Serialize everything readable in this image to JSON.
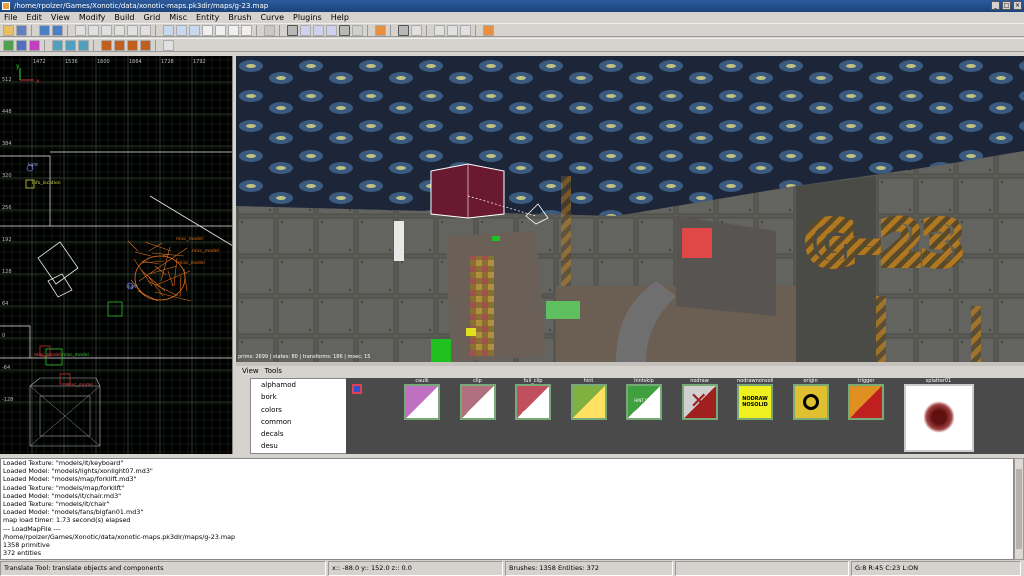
{
  "window": {
    "title": "/home/rpolzer/Games/Xonotic/data/xonotic-maps.pk3dir/maps/g-23.map"
  },
  "menu": [
    "File",
    "Edit",
    "View",
    "Modify",
    "Build",
    "Grid",
    "Misc",
    "Entity",
    "Brush",
    "Curve",
    "Plugins",
    "Help"
  ],
  "xy": {
    "top_ticks": [
      "1472",
      "1536",
      "1600",
      "1664",
      "1728",
      "1792"
    ],
    "left_ticks": [
      "512",
      "448",
      "384",
      "320",
      "256",
      "192",
      "128",
      "64",
      "0",
      "-64",
      "-128"
    ],
    "axis_x": "x",
    "axis_y": "y",
    "entity_labels": [
      "light",
      "info_location",
      "misc_model",
      "misc_model",
      "misc_model",
      "light",
      "misc_model",
      "misc_model",
      "misc_model"
    ]
  },
  "camera": {
    "stats": "prims: 2699 | states: 80 | transforms: 186 | msec: 15",
    "sign_text": "G-23"
  },
  "texture_browser": {
    "menu": [
      "View",
      "Tools"
    ],
    "folders": [
      "alphamod",
      "bork",
      "colors",
      "common",
      "decals",
      "desu"
    ],
    "textures": [
      {
        "name": "caulk",
        "color": "#c070c0",
        "accent": "#ffffff"
      },
      {
        "name": "clip",
        "color": "#b07080",
        "accent": "#ffffff"
      },
      {
        "name": "full_clip",
        "color": "#c05060",
        "accent": "#ffffff"
      },
      {
        "name": "hint",
        "color": "#80b040",
        "accent": "#ffe060"
      },
      {
        "name": "hintskip",
        "color": "#40a040",
        "accent": "#ffffff"
      },
      {
        "name": "nodraw",
        "color": "#d0d0d0",
        "accent": "#a02020"
      },
      {
        "name": "nodrawnonsolid",
        "color": "#f0f020",
        "accent": "#000000"
      },
      {
        "name": "origin",
        "color": "#e0c030",
        "accent": "#000000"
      },
      {
        "name": "trigger",
        "color": "#e09020",
        "accent": "#c02020"
      },
      {
        "name": "splatter01",
        "color": "#ffffff",
        "accent": "#601010"
      }
    ],
    "nodrawnonsolid_text": "NODRAW NOSOLID",
    "hintskip_text": "HINT SKIP"
  },
  "console": {
    "lines": [
      "Loaded Texture: \"models/it/keyboard\"",
      "Loaded Model: \"models/lights/xonlight07.md3\"",
      "Loaded Model: \"models/map/forklift.md3\"",
      "Loaded Texture: \"models/map/forklift\"",
      "Loaded Model: \"models/it/chair.md3\"",
      "Loaded Texture: \"models/it/chair\"",
      "Loaded Model: \"models/fans/bigfan01.md3\"",
      "map load timer:  1.73 second(s) elapsed",
      "--- LoadMapFile ---",
      "/home/rpolzer/Games/Xonotic/data/xonotic-maps.pk3dir/maps/g-23.map",
      "1358 primitive",
      "372 entities"
    ]
  },
  "status": {
    "message": "Translate Tool: translate objects and components",
    "coords": "x::  -88.0  y::  152.0  z::    0.0",
    "counts": "Brushes: 1358 Entities: 372",
    "grid": "G:8  R:45  C:23  L:ON"
  }
}
